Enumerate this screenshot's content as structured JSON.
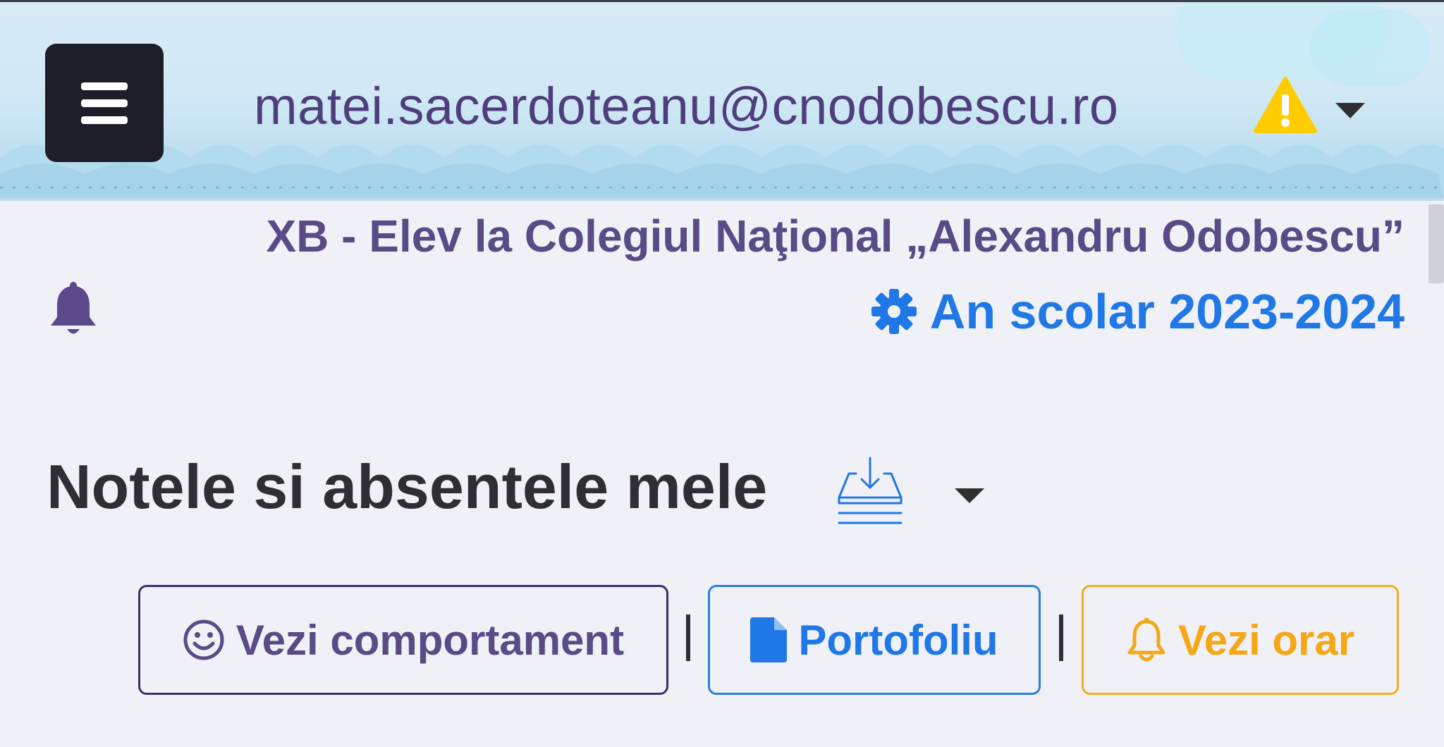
{
  "header": {
    "menu_icon": "hamburger-menu-icon",
    "user_email": "matei.sacerdoteanu@cnodobescu.ro",
    "warning_icon": "warning-triangle-icon",
    "dropdown_icon": "caret-down-icon"
  },
  "info": {
    "class_line": "XB - Elev la Colegiul Naţional „Alexandru Odobescu”",
    "notification_icon": "bell-icon",
    "school_year_icon": "gear-icon",
    "school_year": "An scolar 2023-2024"
  },
  "page": {
    "title": "Notele si absentele mele",
    "download_icon": "download-tray-icon",
    "title_dropdown_icon": "caret-down-icon"
  },
  "actions": [
    {
      "label": "Vezi comportament",
      "icon": "smiley-icon",
      "color": "#584b86"
    },
    {
      "label": "Portofoliu",
      "icon": "file-icon",
      "color": "#1f78e5"
    },
    {
      "label": "Vezi orar",
      "icon": "bell-outline-icon",
      "color": "#f6a715"
    }
  ],
  "separators": [
    "|",
    "|"
  ],
  "colors": {
    "brand_purple": "#584b86",
    "accent_blue": "#1f78e5",
    "accent_orange": "#f6a715",
    "warning_yellow": "#ffcc00",
    "menu_dark": "#1e1e2a"
  }
}
